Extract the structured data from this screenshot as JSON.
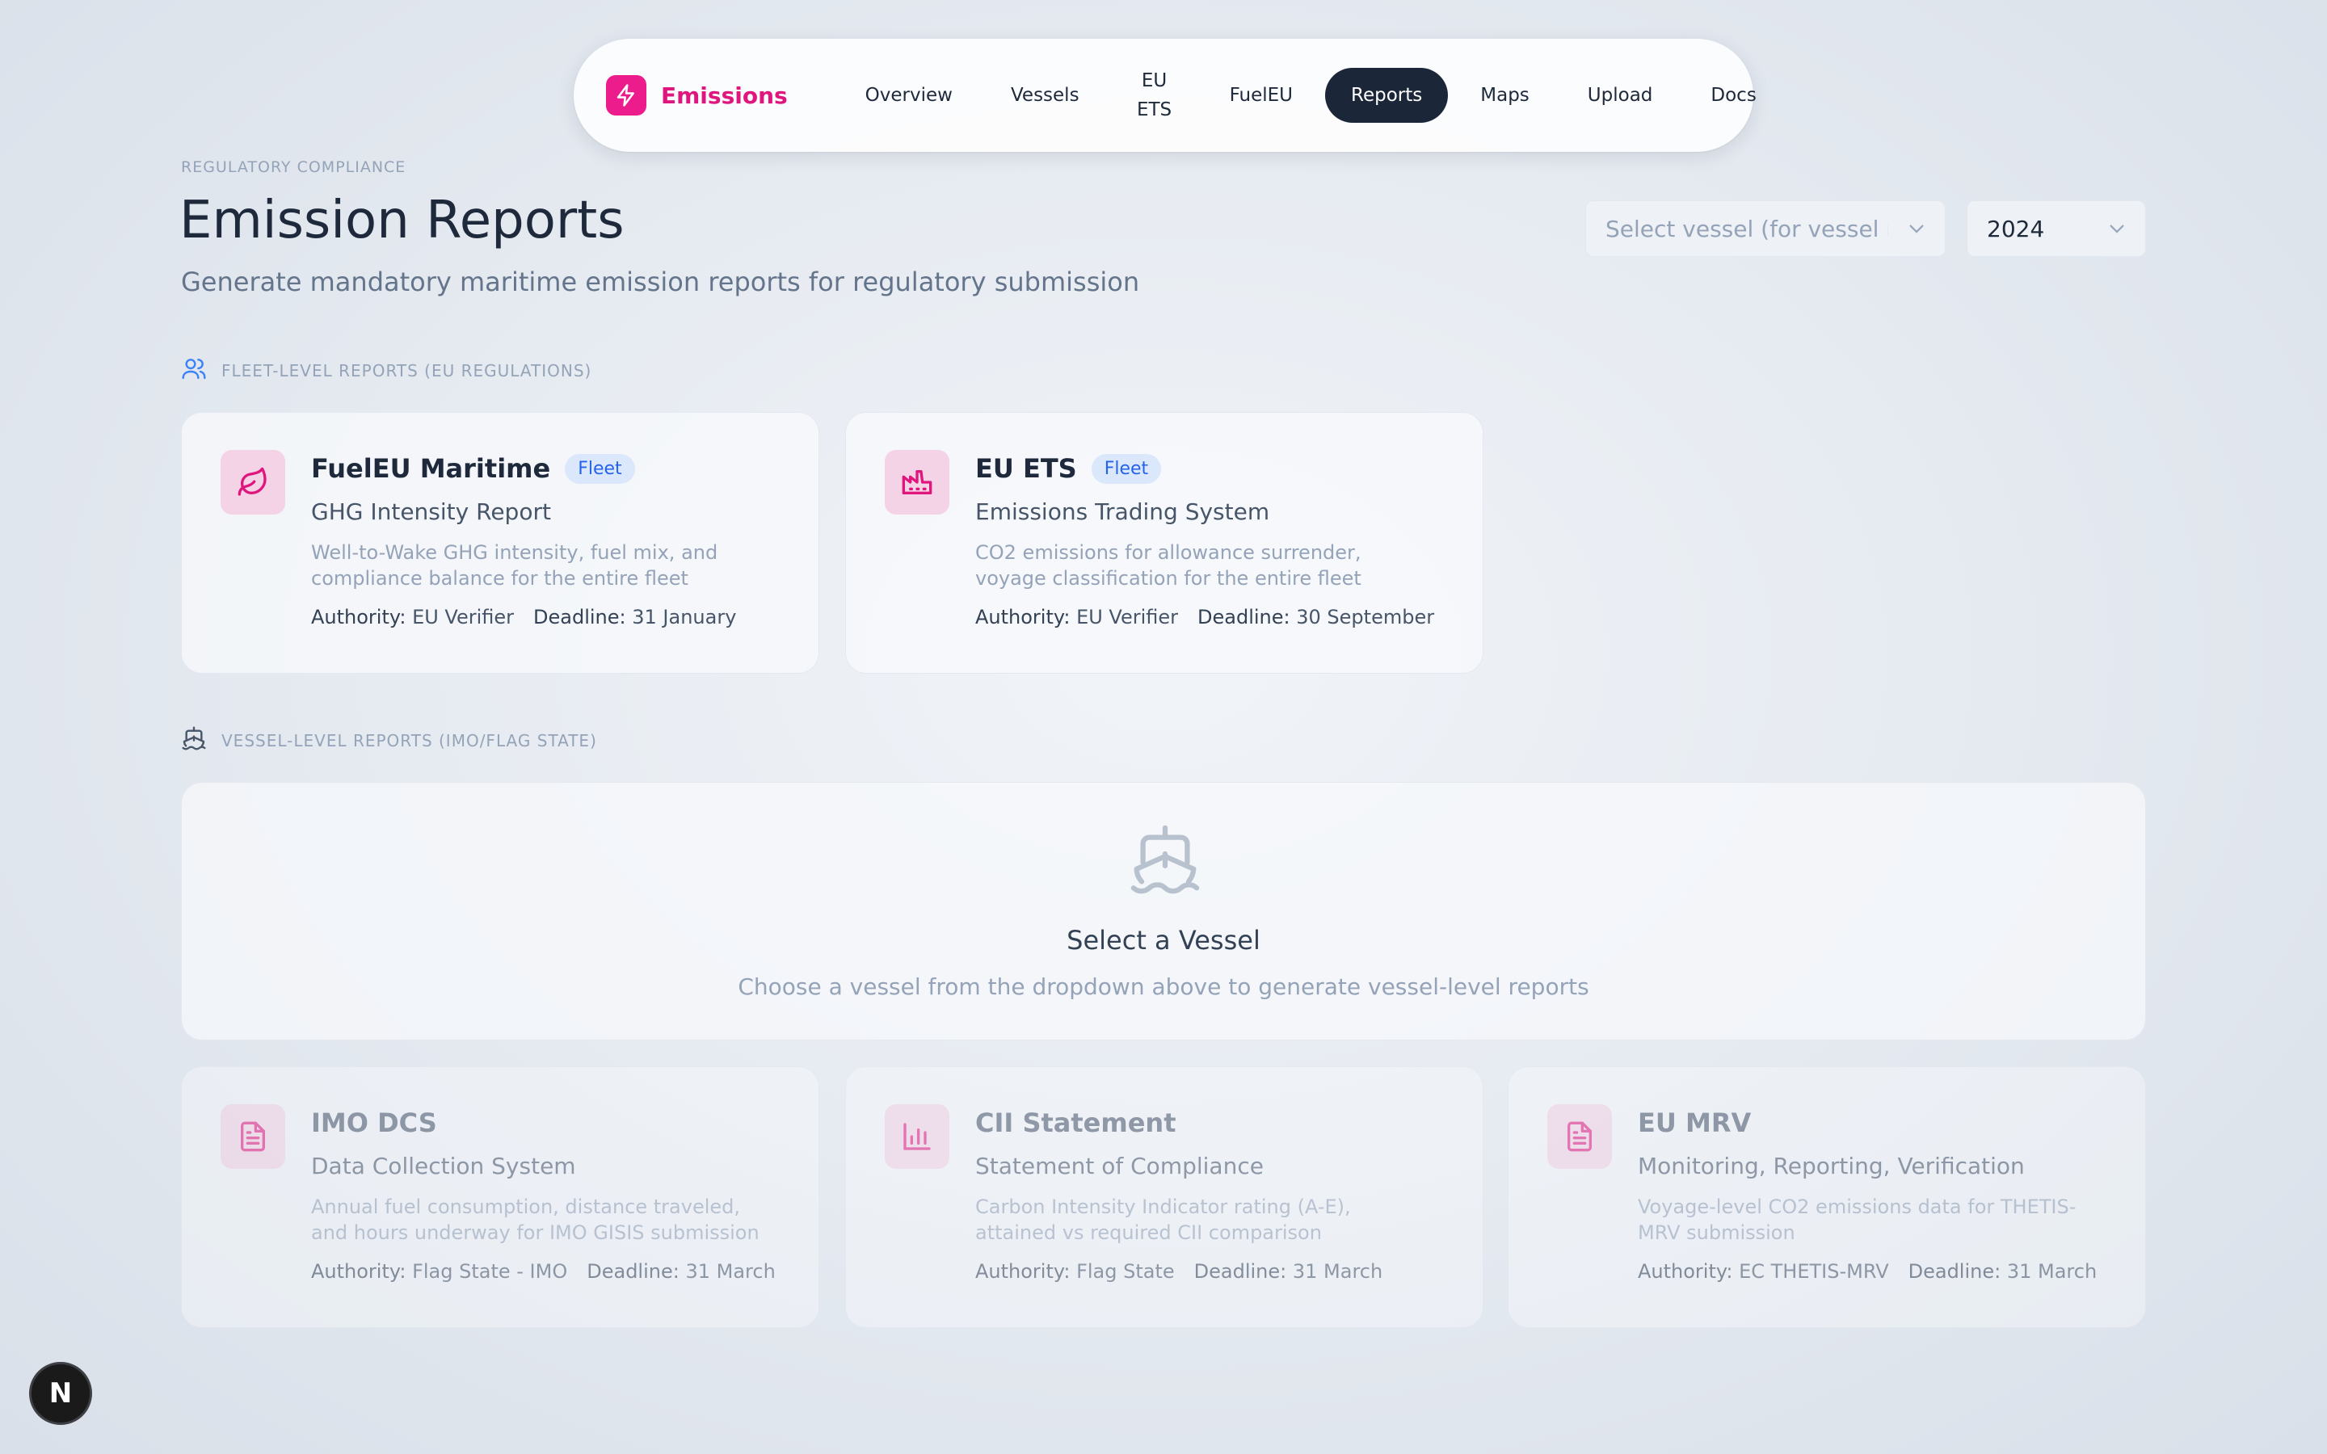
{
  "nav": {
    "brand": "Emissions",
    "items": [
      {
        "label": "Overview"
      },
      {
        "label": "Vessels"
      },
      {
        "label": "EU ETS"
      },
      {
        "label": "FuelEU"
      },
      {
        "label": "Reports",
        "active": true
      },
      {
        "label": "Maps"
      },
      {
        "label": "Upload"
      },
      {
        "label": "Docs"
      }
    ]
  },
  "header": {
    "eyebrow": "REGULATORY COMPLIANCE",
    "title": "Emission Reports",
    "subtitle": "Generate mandatory maritime emission reports for regulatory submission"
  },
  "filters": {
    "vessel_placeholder": "Select vessel (for vessel reports)",
    "year": "2024"
  },
  "fleet_section": {
    "label": "FLEET-LEVEL REPORTS (EU REGULATIONS)",
    "cards": [
      {
        "title": "FuelEU Maritime",
        "badge": "Fleet",
        "subtitle": "GHG Intensity Report",
        "description": "Well-to-Wake GHG intensity, fuel mix, and compliance balance for the entire fleet",
        "authority_label": "Authority:",
        "authority": "EU Verifier",
        "deadline_label": "Deadline:",
        "deadline": "31 January",
        "icon": "leaf-icon"
      },
      {
        "title": "EU ETS",
        "badge": "Fleet",
        "subtitle": "Emissions Trading System",
        "description": "CO2 emissions for allowance surrender, voyage classification for the entire fleet",
        "authority_label": "Authority:",
        "authority": "EU Verifier",
        "deadline_label": "Deadline:",
        "deadline": "30 September",
        "icon": "factory-icon"
      }
    ]
  },
  "vessel_section": {
    "label": "VESSEL-LEVEL REPORTS (IMO/FLAG STATE)",
    "empty_title": "Select a Vessel",
    "empty_desc": "Choose a vessel from the dropdown above to generate vessel-level reports",
    "cards": [
      {
        "title": "IMO DCS",
        "subtitle": "Data Collection System",
        "description": "Annual fuel consumption, distance traveled, and hours underway for IMO GISIS submission",
        "authority_label": "Authority:",
        "authority": "Flag State - IMO",
        "deadline_label": "Deadline:",
        "deadline": "31 March",
        "icon": "document-icon"
      },
      {
        "title": "CII Statement",
        "subtitle": "Statement of Compliance",
        "description": "Carbon Intensity Indicator rating (A-E), attained vs required CII comparison",
        "authority_label": "Authority:",
        "authority": "Flag State",
        "deadline_label": "Deadline:",
        "deadline": "31 March",
        "icon": "bar-chart-icon"
      },
      {
        "title": "EU MRV",
        "subtitle": "Monitoring, Reporting, Verification",
        "description": "Voyage-level CO2 emissions data for THETIS-MRV submission",
        "authority_label": "Authority:",
        "authority": "EC THETIS-MRV",
        "deadline_label": "Deadline:",
        "deadline": "31 March",
        "icon": "document-icon"
      }
    ]
  },
  "dev_badge": "N",
  "colors": {
    "brand": "#e0167f",
    "active_nav": "#1b2638",
    "badge_blue": "#2563eb"
  }
}
